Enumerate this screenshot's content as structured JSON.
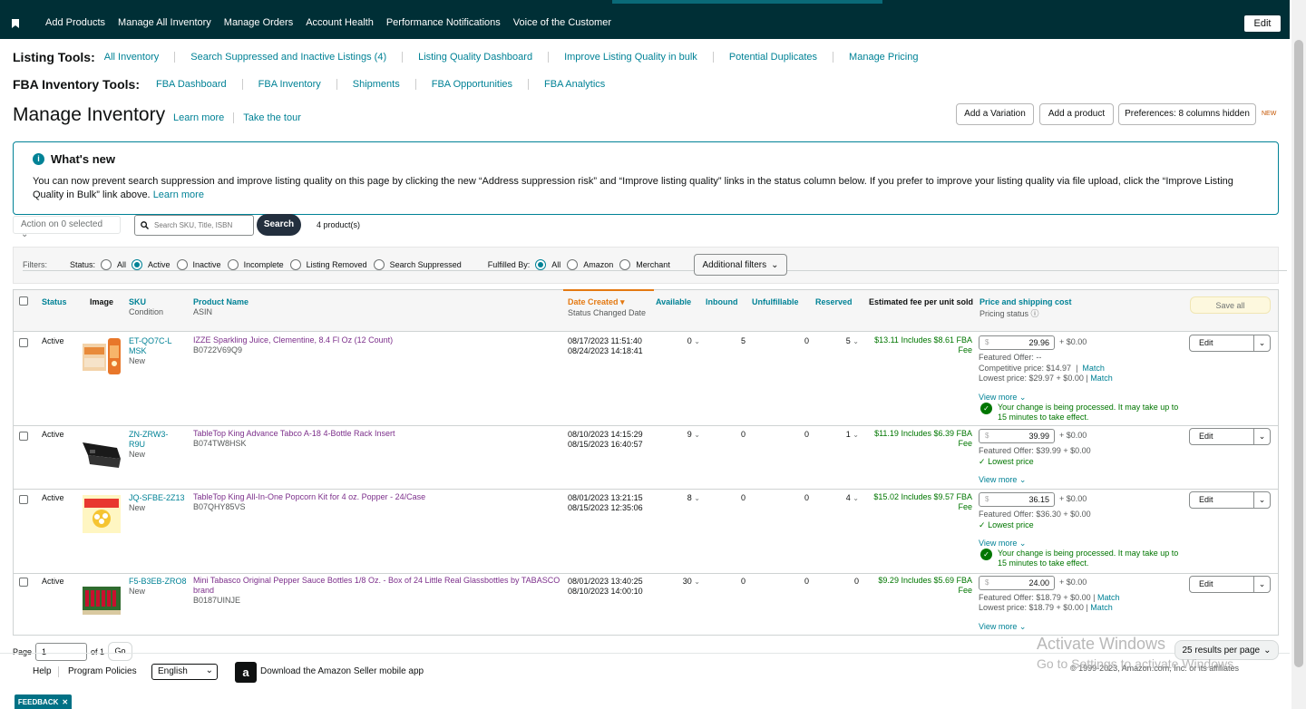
{
  "topnav": {
    "items": [
      "Add Products",
      "Manage All Inventory",
      "Manage Orders",
      "Account Health",
      "Performance Notifications",
      "Voice of the Customer"
    ],
    "edit_label": "Edit"
  },
  "listing_tools": {
    "title": "Listing Tools:",
    "links": [
      "All Inventory",
      "Search Suppressed and Inactive Listings (4)",
      "Listing Quality Dashboard",
      "Improve Listing Quality in bulk",
      "Potential Duplicates",
      "Manage Pricing"
    ]
  },
  "fba_tools": {
    "title": "FBA Inventory Tools:",
    "links": [
      "FBA Dashboard",
      "FBA Inventory",
      "Shipments",
      "FBA Opportunities",
      "FBA Analytics"
    ]
  },
  "page": {
    "title": "Manage Inventory",
    "learn_more": "Learn more",
    "take_tour": "Take the tour",
    "add_variation": "Add a Variation",
    "add_product": "Add a product",
    "preferences": "Preferences: 8 columns hidden",
    "new_tag": "NEW"
  },
  "whats_new": {
    "title": "What's new",
    "body": "You can now prevent search suppression and improve listing quality on this page by clicking the new “Address suppression risk” and “Improve listing quality” links in the status column below. If you prefer to improve your listing quality via file upload, click the “Improve Listing Quality in Bulk” link above.",
    "learn_more": "Learn more"
  },
  "search": {
    "action_label": "Action on 0 selected",
    "placeholder": "Search SKU, Title, ISBN",
    "button": "Search",
    "count": "4 product(s)"
  },
  "filters": {
    "label": "Filters:",
    "status_label": "Status:",
    "status_options": [
      "All",
      "Active",
      "Inactive",
      "Incomplete",
      "Listing Removed",
      "Search Suppressed"
    ],
    "status_selected": "Active",
    "fulfilled_label": "Fulfilled By:",
    "fulfilled_options": [
      "All",
      "Amazon",
      "Merchant"
    ],
    "fulfilled_selected": "All",
    "additional": "Additional filters"
  },
  "columns": {
    "status": "Status",
    "image": "Image",
    "sku": "SKU",
    "sku_sub": "Condition",
    "product_name": "Product Name",
    "product_sub": "ASIN",
    "date_created": "Date Created",
    "date_sub": "Status Changed Date",
    "available": "Available",
    "inbound": "Inbound",
    "unfulfillable": "Unfulfillable",
    "reserved": "Reserved",
    "fee": "Estimated fee per unit sold",
    "price": "Price and shipping cost",
    "price_sub": "Pricing status",
    "save_all": "Save all"
  },
  "rows": [
    {
      "status": "Active",
      "sku": "ET-QO7C-LMSK",
      "condition": "New",
      "name": "IZZE Sparkling Juice, Clementine, 8.4 Fl Oz (12 Count)",
      "asin": "B0722V69Q9",
      "created": "08/17/2023 11:51:40",
      "changed": "08/24/2023 14:18:41",
      "available": "0",
      "inbound": "5",
      "unfulfillable": "0",
      "reserved": "5",
      "fee": "$13.11 Includes $8.61 FBA Fee",
      "price": "29.96",
      "shipping": "+ $0.00",
      "featured": "Featured Offer: --",
      "competitive": "Competitive price: $14.97",
      "lowest": "Lowest price: $29.97 + $0.00",
      "match": "Match",
      "view_more": "View more",
      "processing": "Your change is being processed. It may take up to 15 minutes to take effect.",
      "edit": "Edit"
    },
    {
      "status": "Active",
      "sku": "ZN-ZRW3-R9U",
      "condition": "New",
      "name": "TableTop King Advance Tabco A-18 4-Bottle Rack Insert",
      "asin": "B074TW8HSK",
      "created": "08/10/2023 14:15:29",
      "changed": "08/15/2023 16:40:57",
      "available": "9",
      "inbound": "0",
      "unfulfillable": "0",
      "reserved": "1",
      "fee": "$11.19 Includes $6.39 FBA Fee",
      "price": "39.99",
      "shipping": "+ $0.00",
      "featured": "Featured Offer: $39.99 + $0.00",
      "lowest_badge": "Lowest price",
      "view_more": "View more",
      "edit": "Edit"
    },
    {
      "status": "Active",
      "sku": "JQ-SFBE-2Z13",
      "condition": "New",
      "name": "TableTop King All-In-One Popcorn Kit for 4 oz. Popper - 24/Case",
      "asin": "B07QHY85VS",
      "created": "08/01/2023 13:21:15",
      "changed": "08/15/2023 12:35:06",
      "available": "8",
      "inbound": "0",
      "unfulfillable": "0",
      "reserved": "4",
      "fee": "$15.02 Includes $9.57 FBA Fee",
      "price": "36.15",
      "shipping": "+ $0.00",
      "featured": "Featured Offer: $36.30 + $0.00",
      "lowest_badge": "Lowest price",
      "view_more": "View more",
      "processing": "Your change is being processed. It may take up to 15 minutes to take effect.",
      "edit": "Edit"
    },
    {
      "status": "Active",
      "sku": "F5-B3EB-ZRO8",
      "condition": "New",
      "name": "Mini Tabasco Original Pepper Sauce Bottles 1/8 Oz. - Box of 24 Little Real Glassbottles by TABASCO brand",
      "asin": "B0187UINJE",
      "created": "08/01/2023 13:40:25",
      "changed": "08/10/2023 14:00:10",
      "available": "30",
      "inbound": "0",
      "unfulfillable": "0",
      "reserved": "0",
      "fee": "$9.29 Includes $5.69 FBA Fee",
      "price": "24.00",
      "shipping": "+ $0.00",
      "featured": "Featured Offer: $18.79 + $0.00",
      "lowest": "Lowest price: $18.79 + $0.00",
      "match": "Match",
      "view_more": "View more",
      "edit": "Edit"
    }
  ],
  "pager": {
    "page_label": "Page",
    "page_value": "1",
    "of_label": "of 1",
    "go": "Go",
    "results_per_page": "25 results per page"
  },
  "footer": {
    "help": "Help",
    "policies": "Program Policies",
    "language": "English",
    "download": "Download the Amazon Seller mobile app",
    "copyright": "© 1999-2023, Amazon.com, Inc. or its affiliates"
  },
  "watermark": {
    "line1": "Activate Windows",
    "line2": "Go to Settings to activate Windows."
  },
  "feedback": "FEEDBACK"
}
